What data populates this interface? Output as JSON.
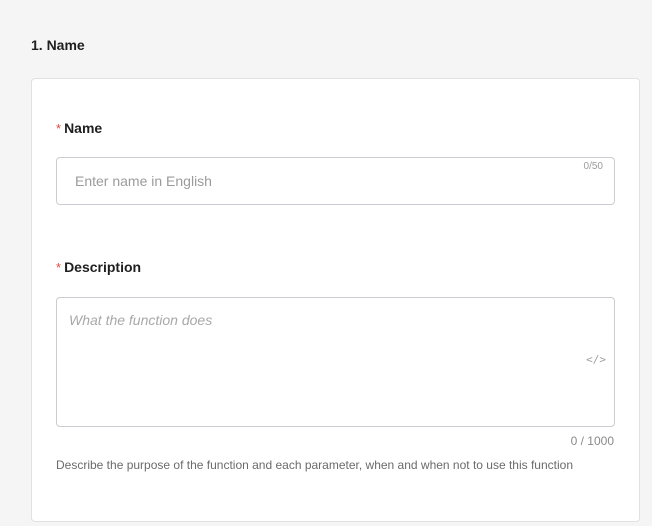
{
  "section": {
    "title": "1. Name"
  },
  "form": {
    "required_mark": "*",
    "name": {
      "label": "Name",
      "placeholder": "Enter name in English",
      "value": "",
      "counter": "0/50"
    },
    "description": {
      "label": "Description",
      "placeholder": "What the function does",
      "value": "",
      "code_toggle_glyph": "</>",
      "counter": "0 / 1000",
      "help_text": "Describe the purpose of the function and each parameter, when and when not to use this function"
    }
  },
  "icons": {
    "code_toggle": "code-icon"
  },
  "colors": {
    "required": "#e0473d",
    "border": "#c9ccd1",
    "placeholder": "#9b9b9b"
  }
}
